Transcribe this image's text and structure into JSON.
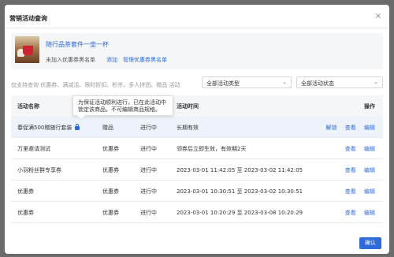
{
  "dialog": {
    "title": "营销活动查询",
    "close_glyph": "×",
    "confirm_label": "确认"
  },
  "product": {
    "name": "随行品茶套件一壶一杯",
    "status_text": "未加入优惠券黑名单",
    "add_link": "添加",
    "manage_link": "管理优惠券黑名单"
  },
  "filters": {
    "hint": "仅支持查询 优惠券、满减活、限时折扣、秒杀、多人拼团、赠品 活动",
    "type_select": "全部活动类型",
    "status_select": "全部活动状态"
  },
  "tooltip": {
    "line1": "为保证活动顺利进行，已在此活动中",
    "line2": "锁定该商品，不可编辑商品规格。"
  },
  "table": {
    "headers": {
      "name": "活动名称",
      "type": "",
      "status": "",
      "time": "活动时间",
      "ops": "操作"
    },
    "rows": [
      {
        "name": "春促满500赠随行套装",
        "type": "赠品",
        "status": "进行中",
        "time": "长期有效",
        "ops": [
          "解锁",
          "查看",
          "编辑"
        ],
        "locked": true
      },
      {
        "name": "万里邀请测试",
        "type": "优惠券",
        "status": "进行中",
        "time": "领券后立即生效，有效期2天",
        "ops": [
          "查看",
          "编辑"
        ]
      },
      {
        "name": "小羽粉丝群专享券",
        "type": "优惠券",
        "status": "进行中",
        "time": "2023-03-01 11:42:05 至 2023-03-02 11:42:05",
        "ops": [
          "查看",
          "编辑"
        ]
      },
      {
        "name": "优惠券",
        "type": "优惠券",
        "status": "进行中",
        "time": "2023-03-01 10:30:51 至 2023-03-02 10:30:51",
        "ops": [
          "查看",
          "编辑"
        ]
      },
      {
        "name": "优惠券",
        "type": "优惠券",
        "status": "进行中",
        "time": "2023-03-01 10:20:29 至 2023-03-08 10:20:29",
        "ops": [
          "查看",
          "编辑"
        ]
      }
    ]
  },
  "colors": {
    "accent": "#2f6bd8",
    "overlay": "#6b6b6b",
    "row_highlight": "#eef3fb"
  }
}
